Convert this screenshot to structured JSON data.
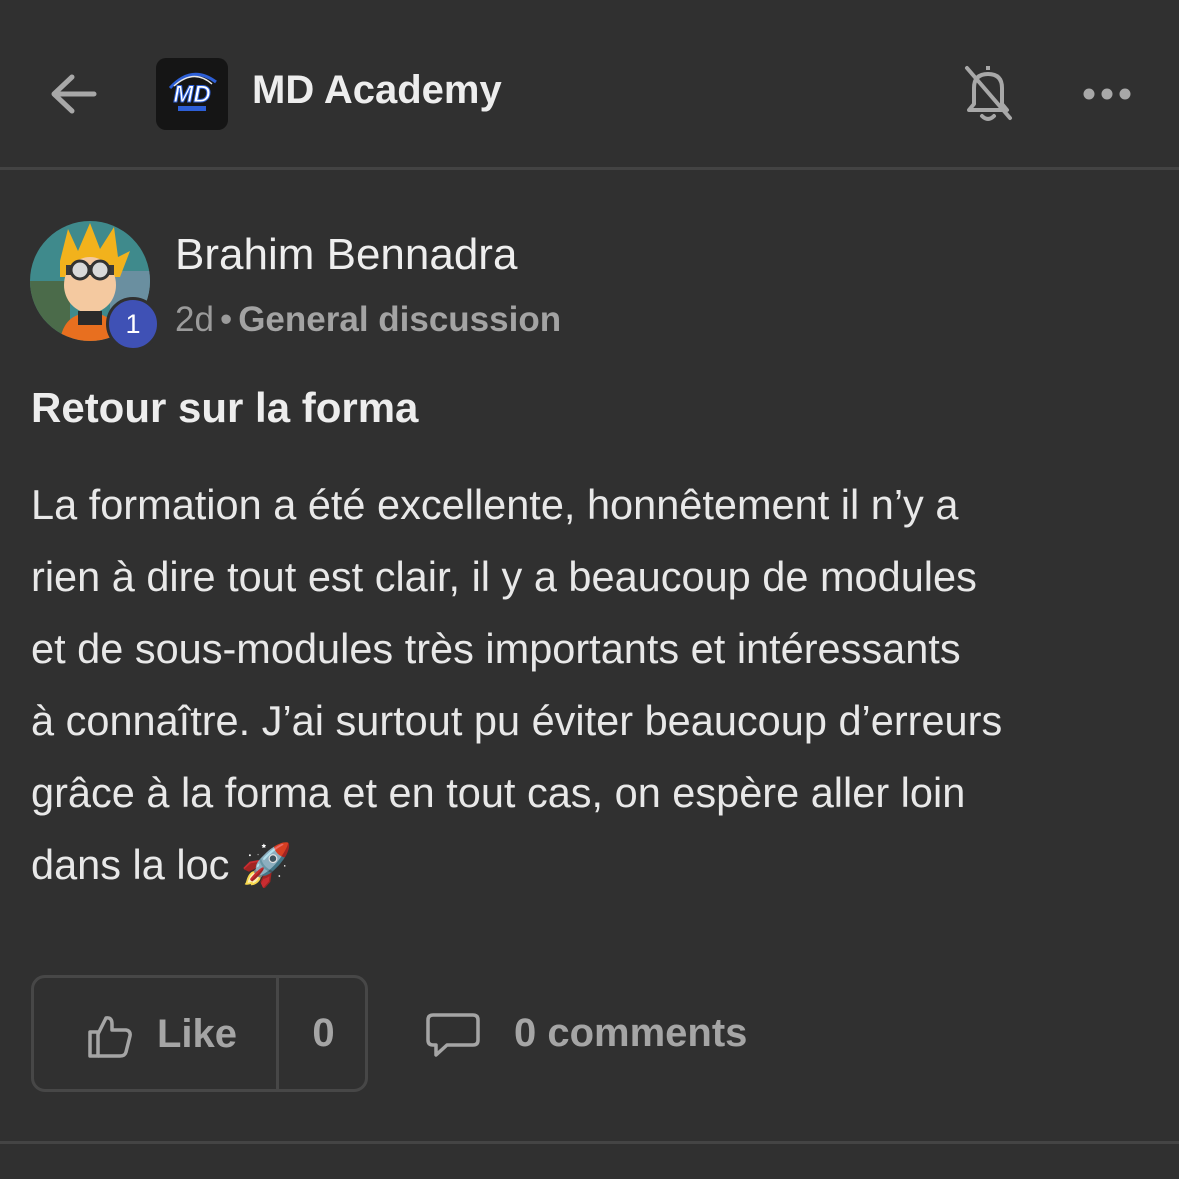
{
  "header": {
    "group_name": "MD Academy",
    "logo_text": "MD",
    "back_icon": "arrow-left-icon",
    "notifications_icon": "bell-off-icon",
    "more_icon": "more-horizontal-icon"
  },
  "post": {
    "author": "Brahim Bennadra",
    "level": "1",
    "time": "2d",
    "separator": "•",
    "category": "General discussion",
    "title": "Retour sur la forma",
    "body_lines": [
      "La formation a été excellente, honnêtement il n’y a",
      "rien à dire tout est clair, il y a beaucoup de modules",
      "et de sous-modules très importants et intéressants",
      "à connaître. J’ai surtout pu éviter beaucoup d’erreurs",
      "grâce à la forma et en tout cas, on espère aller loin",
      "dans la loc 🚀"
    ]
  },
  "actions": {
    "like_label": "Like",
    "like_count": "0",
    "comments_label": "0 comments",
    "like_icon": "thumbs-up-icon",
    "comment_icon": "comment-icon"
  },
  "colors": {
    "background": "#303030",
    "badge": "#3f51b5",
    "muted_text": "#a5a5a5"
  }
}
